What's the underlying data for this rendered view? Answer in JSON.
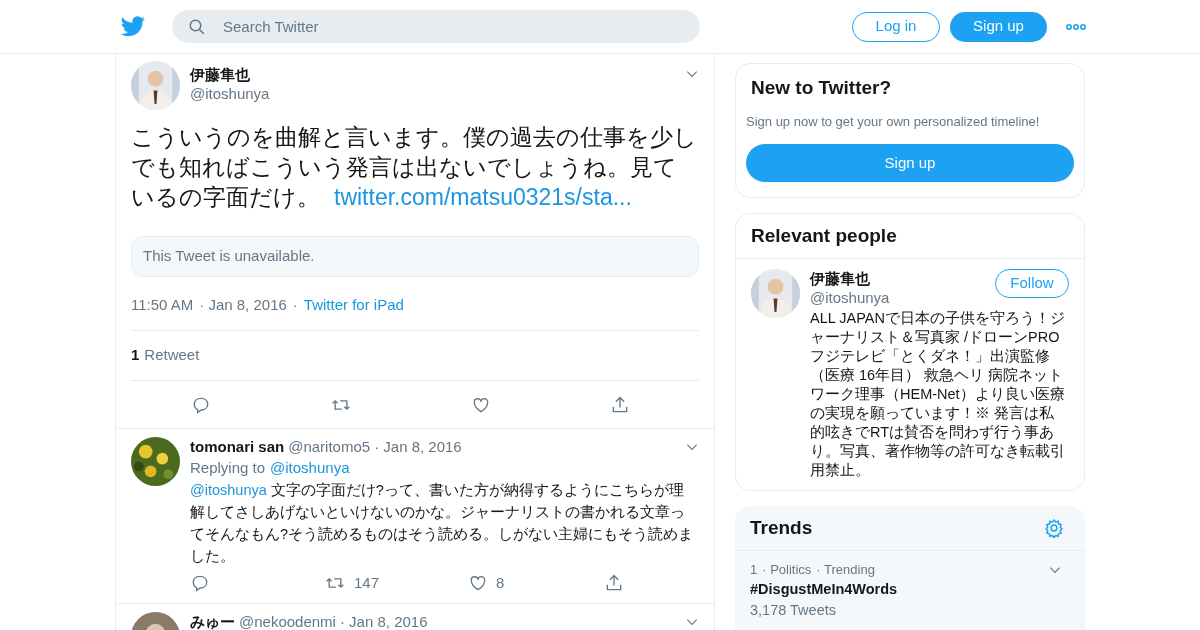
{
  "header": {
    "search": {
      "placeholder": "Search Twitter"
    },
    "login": "Log in",
    "signup": "Sign up"
  },
  "tweet": {
    "name": "伊藤隼也",
    "handle": "@itoshunya",
    "text": "こういうのを曲解と言います。僕の過去の仕事を少しでも知ればこういう発言は出ないでしょうね。見ているの字面だけ。",
    "link": "twitter.com/matsu0321s/sta...",
    "quote": "This Tweet is unavailable.",
    "time": "11:50 AM",
    "date": "· Jan 8, 2016",
    "separator": "·",
    "source": "Twitter for iPad",
    "retweet_count": "1",
    "retweet_label": "Retweet"
  },
  "replies": [
    {
      "name": "tomonari san",
      "handle": "@naritomo5",
      "date": "· Jan 8, 2016",
      "replying_label": "Replying to",
      "replying_to": "@itoshunya",
      "mention": "@itoshunya",
      "text": "文字の字面だけ?って、書いた方が納得するようにこちらが理解してさしあげないといけないのかな。ジャーナリストの書かれる文章ってそんなもん?そう読めるものはそう読める。しがない主婦にもそう読めました。",
      "retweets": "147",
      "likes": "8"
    },
    {
      "name": "みゅー",
      "handle": "@nekoodenmi",
      "date": "· Jan 8, 2016"
    }
  ],
  "new_to_twitter": {
    "title": "New to Twitter?",
    "text": "Sign up now to get your own personalized timeline!",
    "button": "Sign up"
  },
  "relevant_people": {
    "title": "Relevant people",
    "person": {
      "name": "伊藤隼也",
      "handle": "@itoshunya",
      "follow": "Follow",
      "bio": "ALL JAPANで日本の子供を守ろう！ジャーナリスト＆写真家 /ドローンPRO フジテレビ「とくダネ！」出演監修（医療 16年目） 救急ヘリ 病院ネットワーク理事（HEM-Net）より良い医療の実現を願っています！※ 発言は私的呟きでRTは賛否を問わず行う事あり。写真、著作物等の許可なき転載引用禁止。"
    }
  },
  "trends": {
    "title": "Trends",
    "items": [
      {
        "rank": "1",
        "category": "· Politics",
        "status": "· Trending",
        "tag": "#DisgustMeIn4Words",
        "count": "3,178 Tweets"
      }
    ]
  }
}
